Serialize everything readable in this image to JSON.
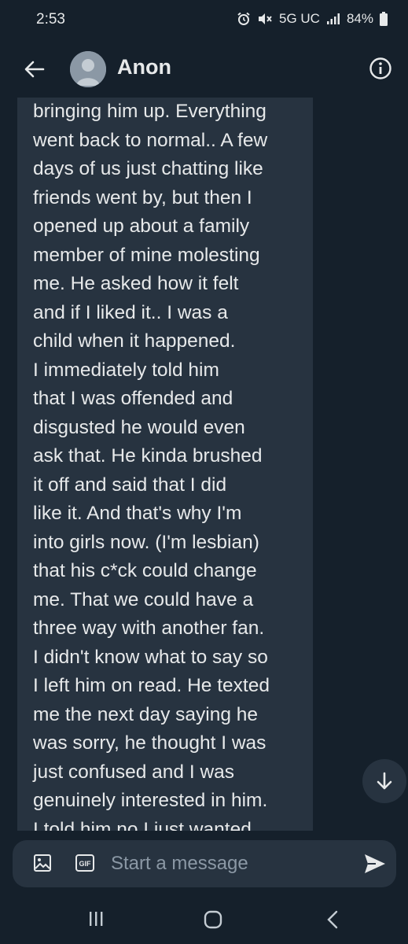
{
  "status_bar": {
    "time": "2:53",
    "network": "5G UC",
    "battery": "84%",
    "icons": [
      "alarm-icon",
      "mute-icon",
      "signal-icon",
      "battery-icon"
    ]
  },
  "header": {
    "title": "Anon",
    "back_icon": "arrow-left-icon",
    "info_icon": "info-icon"
  },
  "message": {
    "lines": [
      "bringing him up. Everything",
      "went back to normal.. A few",
      "days of us just chatting like",
      "friends went by, but then I",
      "opened up about a family",
      "member of mine molesting",
      "me. He asked how it felt",
      "and if I liked it.. I was a",
      "child when it happened.",
      "I immediately told him",
      "that I was offended and",
      "disgusted he would even",
      "ask that. He kinda brushed",
      "it off and said that I did",
      "like it. And that's why I'm",
      "into girls now. (I'm lesbian)",
      "that his c*ck could change",
      "me. That we could have a",
      "three way with another fan.",
      "I didn't know what to say so",
      "I left him on read. He texted",
      "me the next day saying he",
      "was sorry, he thought I was",
      "just confused and I was",
      "genuinely interested in him.",
      "I told him no I just wanted"
    ]
  },
  "composer": {
    "placeholder": "Start a message",
    "gif_label": "GIF"
  },
  "colors": {
    "background": "#15202b",
    "bubble": "#273340",
    "text": "#e7e9ea",
    "muted": "#8b98a5"
  }
}
